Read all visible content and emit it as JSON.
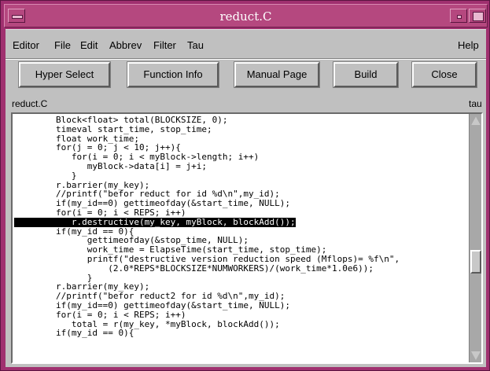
{
  "window": {
    "title": "reduct.C"
  },
  "menubar": {
    "items": [
      {
        "label": "Editor"
      },
      {
        "label": "File"
      },
      {
        "label": "Edit"
      },
      {
        "label": "Abbrev"
      },
      {
        "label": "Filter"
      },
      {
        "label": "Tau"
      }
    ],
    "help": "Help"
  },
  "toolbar": {
    "buttons": [
      {
        "label": "Hyper Select"
      },
      {
        "label": "Function Info"
      },
      {
        "label": "Manual Page"
      },
      {
        "label": "Build"
      },
      {
        "label": "Close"
      }
    ]
  },
  "filebar": {
    "filename": "reduct.C",
    "tool": "tau"
  },
  "editor": {
    "selected_line_index": 12,
    "scroll_position": 0.62,
    "lines": [
      "        Block<float> total(BLOCKSIZE, 0);",
      "        timeval start_time, stop_time;",
      "        float work_time;",
      "        for(j = 0; j < 10; j++){",
      "           for(i = 0; i < myBlock->length; i++)",
      "              myBlock->data[i] = j+i;",
      "           }",
      "        r.barrier(my_key);",
      "        //printf(\"befor reduct for id %d\\n\",my_id);",
      "        if(my_id==0) gettimeofday(&start_time, NULL);",
      "        for(i = 0; i < REPS; i++)",
      "           r.destructive(my_key, myBlock, blockAdd());",
      "        if(my_id == 0){",
      "              gettimeofday(&stop_time, NULL);",
      "              work_time = ElapseTime(start_time, stop_time);",
      "              printf(\"destructive version reduction speed (Mflops)= %f\\n\",",
      "                  (2.0*REPS*BLOCKSIZE*NUMWORKERS)/(work_time*1.0e6));",
      "              }",
      "        r.barrier(my_key);",
      "        //printf(\"befor reduct2 for id %d\\n\",my_id);",
      "        if(my_id==0) gettimeofday(&start_time, NULL);",
      "        for(i = 0; i < REPS; i++)",
      "           total = r(my_key, *myBlock, blockAdd());",
      "        if(my_id == 0){"
    ]
  }
}
